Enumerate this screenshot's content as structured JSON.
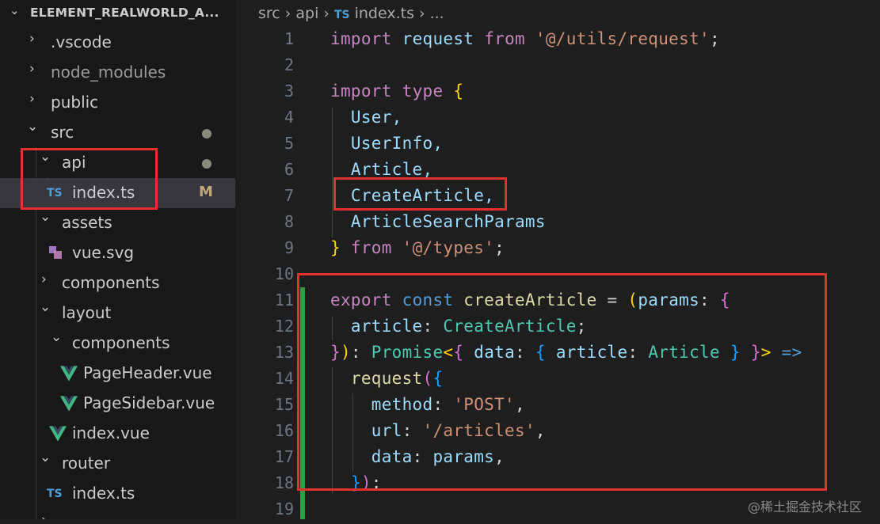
{
  "explorer": {
    "root_title": "ELEMENT_REALWORLD_A...",
    "items": [
      {
        "label": ".vscode",
        "kind": "folder",
        "state": "collapsed"
      },
      {
        "label": "node_modules",
        "kind": "folder",
        "state": "collapsed",
        "dimmed": true
      },
      {
        "label": "public",
        "kind": "folder",
        "state": "collapsed"
      },
      {
        "label": "src",
        "kind": "folder",
        "state": "expanded",
        "badge": "dot"
      },
      {
        "label": "api",
        "kind": "folder",
        "state": "expanded",
        "badge": "dot"
      },
      {
        "label": "index.ts",
        "kind": "file",
        "icon": "TS",
        "badge": "M",
        "selected": true
      },
      {
        "label": "assets",
        "kind": "folder",
        "state": "expanded"
      },
      {
        "label": "vue.svg",
        "kind": "file",
        "icon": "svg"
      },
      {
        "label": "components",
        "kind": "folder",
        "state": "collapsed"
      },
      {
        "label": "layout",
        "kind": "folder",
        "state": "expanded"
      },
      {
        "label": "components",
        "kind": "folder",
        "state": "expanded"
      },
      {
        "label": "PageHeader.vue",
        "kind": "file",
        "icon": "vue"
      },
      {
        "label": "PageSidebar.vue",
        "kind": "file",
        "icon": "vue"
      },
      {
        "label": "index.vue",
        "kind": "file",
        "icon": "vue"
      },
      {
        "label": "router",
        "kind": "folder",
        "state": "expanded"
      },
      {
        "label": "index.ts",
        "kind": "file",
        "icon": "TS"
      }
    ],
    "ts_icon_text": "TS",
    "modified_badge": "M"
  },
  "breadcrumb": {
    "parts": [
      "src",
      "api",
      "index.ts",
      "..."
    ],
    "file_icon": "TS"
  },
  "editor": {
    "lines": [
      {
        "n": "1"
      },
      {
        "n": "2"
      },
      {
        "n": "3"
      },
      {
        "n": "4"
      },
      {
        "n": "5"
      },
      {
        "n": "6"
      },
      {
        "n": "7"
      },
      {
        "n": "8"
      },
      {
        "n": "9"
      },
      {
        "n": "10"
      },
      {
        "n": "11"
      },
      {
        "n": "12"
      },
      {
        "n": "13"
      },
      {
        "n": "14"
      },
      {
        "n": "15"
      },
      {
        "n": "16"
      },
      {
        "n": "17"
      },
      {
        "n": "18"
      },
      {
        "n": "19"
      }
    ],
    "code": {
      "l1": [
        "import",
        " ",
        "request",
        " ",
        "from",
        " ",
        "'@/utils/request'",
        ";"
      ],
      "l3": [
        "import",
        " ",
        "type",
        " ",
        "{"
      ],
      "l4": "  User,",
      "l5": "  UserInfo,",
      "l6": "  Article,",
      "l7": "  CreateArticle,",
      "l8": "  ArticleSearchParams",
      "l9": [
        "}",
        " ",
        "from",
        " ",
        "'@/types'",
        ";"
      ],
      "l11": [
        "export",
        " ",
        "const",
        " ",
        "createArticle",
        " = ",
        "(",
        "params",
        ": ",
        "{"
      ],
      "l12": [
        "  ",
        "article",
        ": ",
        "CreateArticle",
        ";"
      ],
      "l13": [
        "}",
        ")",
        ": ",
        "Promise",
        "<",
        "{",
        " ",
        "data",
        ": ",
        "{",
        " ",
        "article",
        ": ",
        "Article",
        " ",
        "}",
        " ",
        "}",
        ">",
        " ",
        "=>"
      ],
      "l14": [
        "  ",
        "request",
        "(",
        "{"
      ],
      "l15": [
        "    ",
        "method",
        ": ",
        "'POST'",
        ","
      ],
      "l16": [
        "    ",
        "url",
        ": ",
        "'/articles'",
        ","
      ],
      "l17": [
        "    ",
        "data",
        ": ",
        "params",
        ","
      ],
      "l18": [
        "  ",
        "}",
        ")",
        ";"
      ]
    }
  },
  "watermark": "@稀土掘金技术社区",
  "colors": {
    "background": "#1e1e1e",
    "sidebar": "#181818",
    "selection": "#37373d",
    "highlight_box": "#e8312f",
    "gutter_added": "#2ea043",
    "ts_icon": "#4d9fd8",
    "vue_icon": "#41b883"
  }
}
